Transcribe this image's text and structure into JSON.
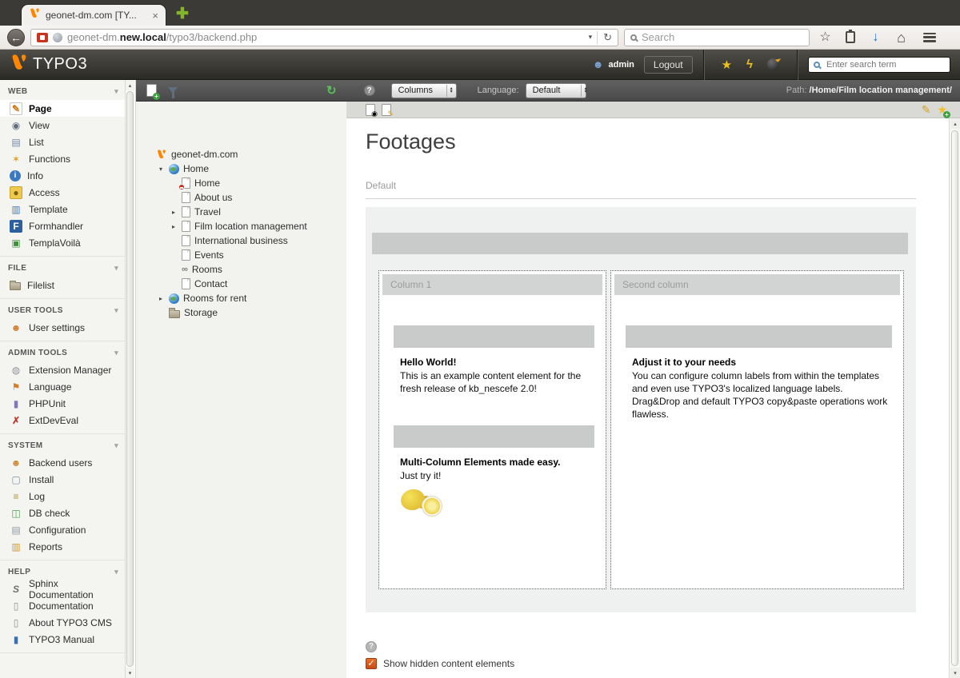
{
  "browser": {
    "tab_title": "geonet-dm.com [TY...",
    "url": {
      "prefix": "geonet-dm.",
      "bold": "new.local",
      "path": "/typo3/backend.php"
    },
    "search_placeholder": "Search"
  },
  "topbar": {
    "logo": "TYPO3",
    "username": "admin",
    "logout": "Logout",
    "search_placeholder": "Enter search term"
  },
  "docheader": {
    "columns_value": "Columns",
    "language_label": "Language:",
    "language_value": "Default",
    "path_label": "Path: ",
    "path_value": "/Home/Film location management/"
  },
  "sidebar": {
    "sections": [
      {
        "label": "WEB",
        "items": [
          {
            "label": "Page",
            "icon": "page-module",
            "active": true
          },
          {
            "label": "View",
            "icon": "view"
          },
          {
            "label": "List",
            "icon": "list"
          },
          {
            "label": "Functions",
            "icon": "functions"
          },
          {
            "label": "Info",
            "icon": "info"
          },
          {
            "label": "Access",
            "icon": "access"
          },
          {
            "label": "Template",
            "icon": "template"
          },
          {
            "label": "Formhandler",
            "icon": "formhandler"
          },
          {
            "label": "TemplaVoilà",
            "icon": "templavoila"
          }
        ]
      },
      {
        "label": "FILE",
        "items": [
          {
            "label": "Filelist",
            "icon": "filelist"
          }
        ]
      },
      {
        "label": "USER TOOLS",
        "items": [
          {
            "label": "User settings",
            "icon": "user-settings"
          }
        ]
      },
      {
        "label": "ADMIN TOOLS",
        "items": [
          {
            "label": "Extension Manager",
            "icon": "extension-manager"
          },
          {
            "label": "Language",
            "icon": "language"
          },
          {
            "label": "PHPUnit",
            "icon": "phpunit"
          },
          {
            "label": "ExtDevEval",
            "icon": "extdeveval"
          }
        ]
      },
      {
        "label": "SYSTEM",
        "items": [
          {
            "label": "Backend users",
            "icon": "backend-users"
          },
          {
            "label": "Install",
            "icon": "install"
          },
          {
            "label": "Log",
            "icon": "log"
          },
          {
            "label": "DB check",
            "icon": "db-check"
          },
          {
            "label": "Configuration",
            "icon": "configuration"
          },
          {
            "label": "Reports",
            "icon": "reports"
          }
        ]
      },
      {
        "label": "HELP",
        "items": [
          {
            "label": "Sphinx Documentation",
            "icon": "sphinx-documentation"
          },
          {
            "label": "Documentation",
            "icon": "documentation"
          },
          {
            "label": "About TYPO3 CMS",
            "icon": "about-typo3-cms"
          },
          {
            "label": "TYPO3 Manual",
            "icon": "typo3-manual"
          }
        ]
      }
    ]
  },
  "tree": {
    "nodes": [
      {
        "label": "geonet-dm.com",
        "icon": "typo3",
        "level": 0,
        "expander": ""
      },
      {
        "label": "Home",
        "icon": "globe",
        "level": 1,
        "expander": "open"
      },
      {
        "label": "Home",
        "icon": "page-shortcut",
        "level": 2,
        "expander": ""
      },
      {
        "label": "About us",
        "icon": "page",
        "level": 2,
        "expander": ""
      },
      {
        "label": "Travel",
        "icon": "page",
        "level": 2,
        "expander": "closed"
      },
      {
        "label": "Film location management",
        "icon": "page",
        "level": 2,
        "expander": "closed"
      },
      {
        "label": "International business",
        "icon": "page",
        "level": 2,
        "expander": ""
      },
      {
        "label": "Events",
        "icon": "page",
        "level": 2,
        "expander": ""
      },
      {
        "label": "Rooms",
        "icon": "link",
        "level": 2,
        "expander": ""
      },
      {
        "label": "Contact",
        "icon": "page",
        "level": 2,
        "expander": ""
      },
      {
        "label": "Rooms for rent",
        "icon": "globe",
        "level": 1,
        "expander": "closed"
      },
      {
        "label": "Storage",
        "icon": "folder",
        "level": 1,
        "expander": ""
      }
    ]
  },
  "main": {
    "title": "Footages",
    "tab_label": "Default",
    "columns": [
      {
        "header": "Column 1",
        "elements": [
          {
            "type": "bar"
          },
          {
            "type": "text",
            "heading": "Hello World!",
            "paragraphs": [
              "This is an example content element for the fresh release of kb_nescefe 2.0!"
            ]
          },
          {
            "type": "bar"
          },
          {
            "type": "text",
            "heading": "Multi-Column Elements made easy.",
            "paragraphs": [
              "Just try it!"
            ]
          },
          {
            "type": "image",
            "alt": "lemons"
          }
        ]
      },
      {
        "header": "Second column",
        "elements": [
          {
            "type": "bar"
          },
          {
            "type": "text",
            "heading": "Adjust it to your needs",
            "paragraphs": [
              "You can configure column labels from within the templates and even use TYPO3's localized language labels.",
              "Drag&Drop and default TYPO3 copy&paste operations work flawless."
            ]
          }
        ]
      }
    ],
    "show_hidden_label": "Show hidden content elements"
  },
  "icons": {
    "close": "×",
    "new_tab": "✚",
    "back": "←",
    "caret_down": "▾",
    "reload": "↻",
    "star_filled": "★",
    "star_outline": "☆",
    "bolt": "ϟ",
    "download_arrow": "↓",
    "home": "⌂",
    "refresh": "↻",
    "help": "?",
    "pencil": "✎",
    "view_glyph": "◉",
    "check": "✓",
    "scroll_up": "▴",
    "scroll_down": "▾"
  },
  "colors": {
    "accent_orange": "#ff8700",
    "checkbox_orange": "#d9531e",
    "link_blue": "#1f6fd6"
  }
}
